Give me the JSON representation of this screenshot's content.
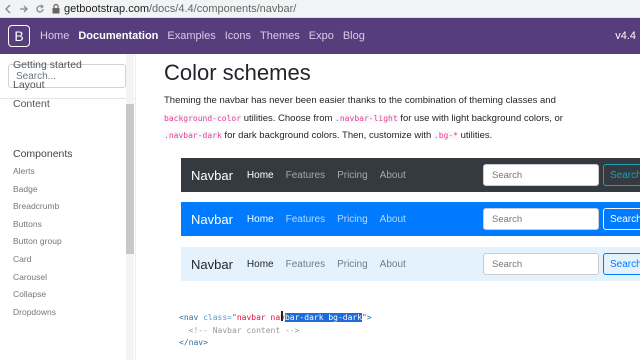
{
  "browser": {
    "url_host": "getbootstrap.com",
    "url_path": "/docs/4.4/components/navbar/"
  },
  "topnav": {
    "brand_letter": "B",
    "links": [
      "Home",
      "Documentation",
      "Examples",
      "Icons",
      "Themes",
      "Expo",
      "Blog"
    ],
    "active": "Documentation",
    "version": "v4.4"
  },
  "sidebar": {
    "search_placeholder": "Search...",
    "items": [
      "Getting started",
      "Layout",
      "Content"
    ],
    "components_heading": "Components",
    "components": [
      "Alerts",
      "Badge",
      "Breadcrumb",
      "Buttons",
      "Button group",
      "Card",
      "Carousel",
      "Collapse",
      "Dropdowns"
    ]
  },
  "content": {
    "title": "Color schemes",
    "para_1": "Theming the navbar has never been easier thanks to the combination of theming classes and",
    "code_1": "background-color",
    "para_2": " utilities. Choose from ",
    "code_2": ".navbar-light",
    "para_3": " for use with light background colors, or",
    "code_3": ".navbar-dark",
    "para_4": " for dark background colors. Then, customize with ",
    "code_4": ".bg-*",
    "para_5": " utilities."
  },
  "demos": [
    {
      "variant": "dark",
      "brand": "Navbar",
      "links": [
        "Home",
        "Features",
        "Pricing",
        "About"
      ],
      "search_placeholder": "Search",
      "button": "Search"
    },
    {
      "variant": "primary",
      "brand": "Navbar",
      "links": [
        "Home",
        "Features",
        "Pricing",
        "About"
      ],
      "search_placeholder": "Search",
      "button": "Search"
    },
    {
      "variant": "light",
      "brand": "Navbar",
      "links": [
        "Home",
        "Features",
        "Pricing",
        "About"
      ],
      "search_placeholder": "Search",
      "button": "Search"
    }
  ],
  "code": {
    "line1_open": "<nav ",
    "line1_attr": "class=",
    "line1_str_a": "\"navbar nav",
    "line1_hl": "bar-dark bg-dark",
    "line1_str_b": "\"",
    "line1_close": ">",
    "line2": "<!-- Navbar content -->",
    "line3": "</nav>"
  },
  "colors": {
    "bootstrap_purple": "#563d7c",
    "dark_bg": "#343a40",
    "primary_bg": "#007bff",
    "light_bg": "#e3f2fd",
    "code_pink": "#e83e8c",
    "selection": "#1d6ad8"
  },
  "icons": [
    "back-arrow-icon",
    "forward-arrow-icon",
    "reload-icon",
    "lock-icon"
  ]
}
